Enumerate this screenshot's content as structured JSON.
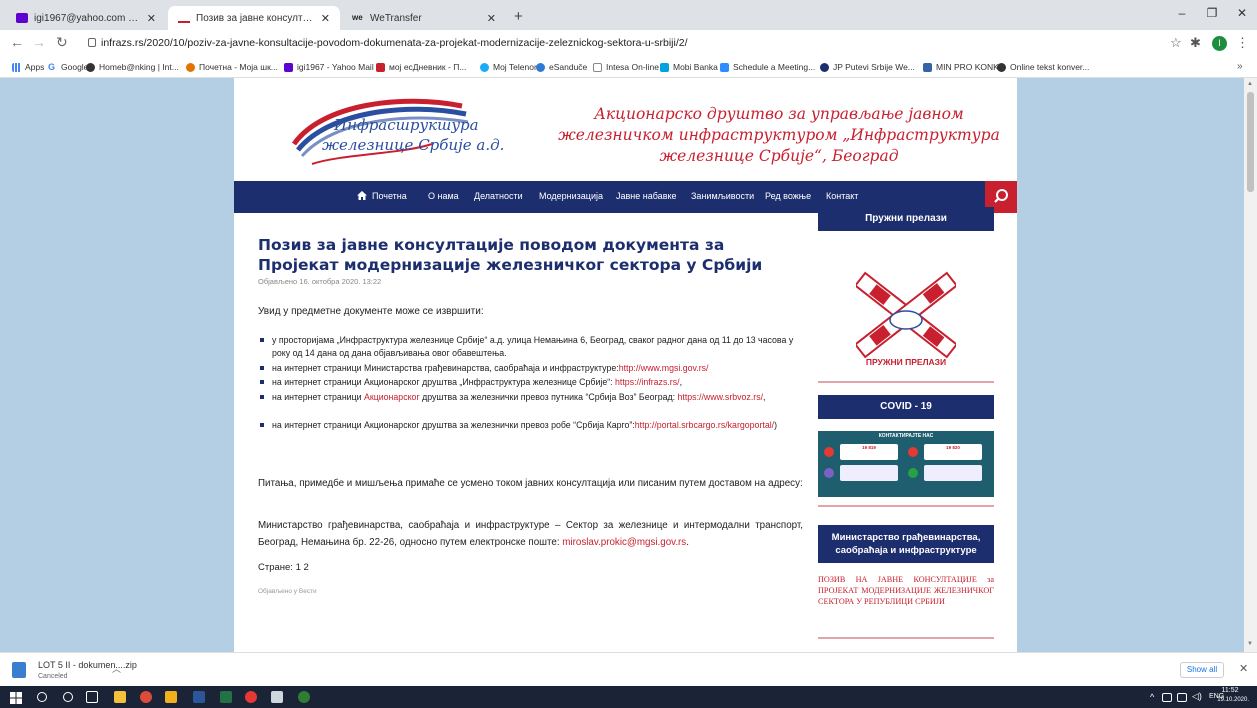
{
  "browser": {
    "tabs": [
      {
        "title": "igi1967@yahoo.com - Yahoo Ma",
        "active": false
      },
      {
        "title": "Позив за јавне консултације по",
        "active": true
      },
      {
        "title": "WeTransfer",
        "active": false
      }
    ],
    "new_tab": "+",
    "url": "infrazs.rs/2020/10/poziv-za-javne-konsultacije-povodom-dokumenata-za-projekat-modernizacije-zeleznickog-sektora-u-srbiji/2/",
    "profile_initial": "I",
    "bookmarks": [
      "Apps",
      "Google",
      "Homeb@nking | Int...",
      "Почетна - Моја шк...",
      "igi1967 - Yahoo Mail",
      "мој есДневник - П...",
      "Moj Telenor",
      "eSanduče",
      "Intesa On-line",
      "Mobi Banka",
      "Schedule a Meeting...",
      "JP Putevi Srbije We...",
      "MIN PRO KONK",
      "Online tekst konver..."
    ],
    "bookmarks_more": "»"
  },
  "site": {
    "logo_line1": "Инфрасшрукшура",
    "logo_line2": "железнице Србије а.д.",
    "company_name": "Акционарско друштво за управљање јавном железничком инфраструктуром „Инфраструктура железнице Србије“, Београд",
    "nav": [
      "Почетна",
      "О нама",
      "Делатности",
      "Модернизација",
      "Јавне набавке",
      "Занимљивости",
      "Ред вожње",
      "Контакт"
    ],
    "colors": {
      "navy": "#1d2e6e",
      "red": "#c8202f"
    }
  },
  "article": {
    "title": "Позив за јавне консултације поводом документа за Пројекат модернизације железничког сектора у Србији",
    "date": "Објављено 16. октобра 2020. 13:22",
    "intro": "Увид у предметне документе  може се извршити:",
    "bullets": [
      {
        "text": "у просторијама „Инфраструктура железнице Србије“ а.д. улица Немањина 6, Београд, сваког радног дана од 11 до 13 часова у року од 14 дана од дана објављивања овог обавештења."
      },
      {
        "text": "на интернет страници Министарства грађевинарства, саобраћаја и инфраструктуре:",
        "link": "http://www.mgsi.gov.rs/"
      },
      {
        "text": "на интернет страници Акционарског друштва „Инфраструктура железнице Србије“: ",
        "link": "https://infrazs.rs/",
        "after": ","
      },
      {
        "pre": "на интернет страници ",
        "link": "Акционарског",
        "text": " друштва за железнички превоз путника “Србија Воз” Београд: ",
        "link2": "https://www.srbvoz.rs/",
        "after": ","
      },
      {
        "text": "на интернет страници   Акционарског друштва за железнички превоз робе “Србија Карго”:",
        "link": "http://portal.srbcargo.rs/kargoportal/",
        "after": ")"
      }
    ],
    "para1": "Питања, примедбе и мишљења примаће се усмено током јавних консултација или писаним путем доставом на адресу:",
    "para2_text": "Министарство грађевинарства, саобраћаја и инфраструктуре – Сектор за железнице и интермодални транспорт, Београд, Немањина бр. 22-26, односно путем електронске поште:  ",
    "para2_link": "miroslav.prokic@mgsi.gov.rs",
    "para2_end": ".",
    "pages_label": "Стране: 1 2",
    "posted_in": "Објављено у Вести"
  },
  "sidebar": {
    "crossings_title": "Пружни прелази",
    "crossings_label": "ПРУЖНИ ПРЕЛАЗИ",
    "covid_title": "COVID - 19",
    "covid_top": "КОНТАКТИРАЈТЕ НАС",
    "covid_num1": "19 819",
    "covid_num2": "19 820",
    "ministry_title": "Министарство грађевинарства, саобраћаја и инфраструктуре",
    "ministry_link": "ПОЗИВ НА ЈАВНЕ КОНСУЛТАЦИЈЕ за ПРОЈЕКАТ МОДЕРНИЗАЦИЈЕ ЖЕЛЕЗНИЧКОГ СЕКТОРА У РЕПУБЛИЦИ СРБИЈИ"
  },
  "download": {
    "filename": "LOT 5 II - dokumen....zip",
    "status": "Canceled",
    "show_all": "Show all"
  },
  "taskbar": {
    "lang": "ENG",
    "time": "11:52",
    "date": "19.10.2020."
  }
}
